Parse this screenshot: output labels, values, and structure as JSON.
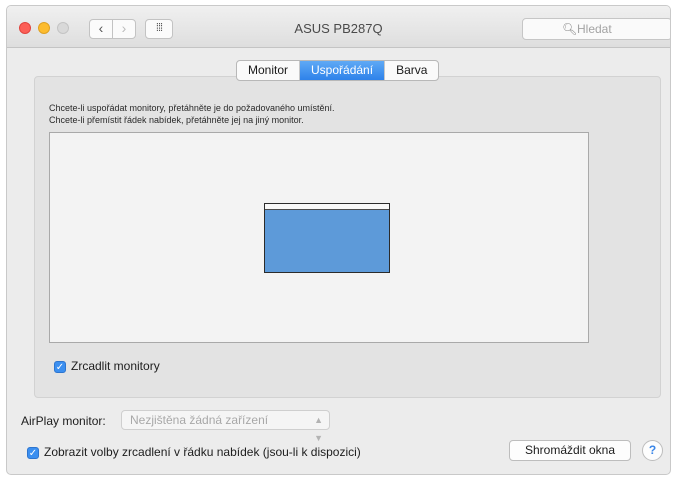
{
  "window": {
    "title": "ASUS PB287Q",
    "search": {
      "placeholder": "Hledat"
    },
    "nav": {
      "back_glyph": "‹",
      "forward_glyph": "›",
      "grid_glyph": "⁞⁞⁞"
    }
  },
  "tabs": [
    {
      "label": "Monitor",
      "active": false
    },
    {
      "label": "Uspořádání",
      "active": true
    },
    {
      "label": "Barva",
      "active": false
    }
  ],
  "arrangement": {
    "instruction_1": "Chcete-li uspořádat monitory, přetáhněte je do požadovaného umístění.",
    "instruction_2": "Chcete-li přemístit řádek nabídek, přetáhněte jej na jiný monitor.",
    "display_color": "#5d9ad9"
  },
  "mirror": {
    "label": "Zrcadlit monitory",
    "checked": true
  },
  "airplay": {
    "label": "AirPlay monitor:",
    "selected": "Nezjištěna žádná zařízení"
  },
  "menubar_option": {
    "label": "Zobrazit volby zrcadlení v řádku nabídek (jsou-li k dispozici)",
    "checked": true
  },
  "buttons": {
    "gather": "Shromáždit okna",
    "help": "?"
  },
  "colors": {
    "accent": "#3b8ff0",
    "traffic_red": "#fc5f57",
    "traffic_yellow": "#fdbc2e"
  }
}
